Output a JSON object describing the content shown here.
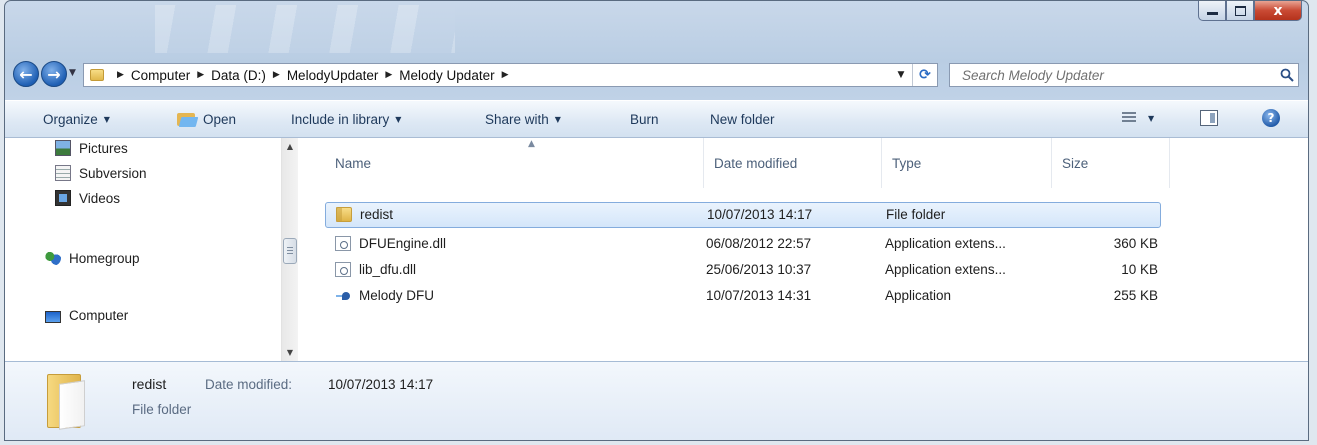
{
  "window": {
    "close_glyph": "x"
  },
  "address": {
    "crumbs": [
      "Computer",
      "Data (D:)",
      "MelodyUpdater",
      "Melody Updater"
    ],
    "refresh_glyph": "⟳"
  },
  "search": {
    "placeholder": "Search Melody Updater"
  },
  "toolbar": {
    "organize": "Organize",
    "open": "Open",
    "include_in_library": "Include in library",
    "share_with": "Share with",
    "burn": "Burn",
    "new_folder": "New folder",
    "help_glyph": "?"
  },
  "navpane": {
    "items": [
      {
        "label": "Pictures",
        "icon": "pictures-icon"
      },
      {
        "label": "Subversion",
        "icon": "subversion-icon"
      },
      {
        "label": "Videos",
        "icon": "videos-icon"
      },
      {
        "label": "Homegroup",
        "icon": "homegroup-icon"
      },
      {
        "label": "Computer",
        "icon": "computer-icon"
      }
    ]
  },
  "columns": {
    "name": "Name",
    "date": "Date modified",
    "type": "Type",
    "size": "Size"
  },
  "files": [
    {
      "name": "redist",
      "date": "10/07/2013 14:17",
      "type": "File folder",
      "size": "",
      "icon": "folder-icon",
      "selected": true
    },
    {
      "name": "DFUEngine.dll",
      "date": "06/08/2012 22:57",
      "type": "Application extens...",
      "size": "360 KB",
      "icon": "dll-icon"
    },
    {
      "name": "lib_dfu.dll",
      "date": "25/06/2013 10:37",
      "type": "Application extens...",
      "size": "10 KB",
      "icon": "dll-icon"
    },
    {
      "name": "Melody DFU",
      "date": "10/07/2013 14:31",
      "type": "Application",
      "size": "255 KB",
      "icon": "application-icon"
    }
  ],
  "details": {
    "name": "redist",
    "date_label": "Date modified:",
    "date_value": "10/07/2013 14:17",
    "type": "File folder"
  },
  "colors": {
    "selection_border": "#84acdd",
    "toolbar_text": "#1e395b",
    "close_button": "#c94a34"
  }
}
